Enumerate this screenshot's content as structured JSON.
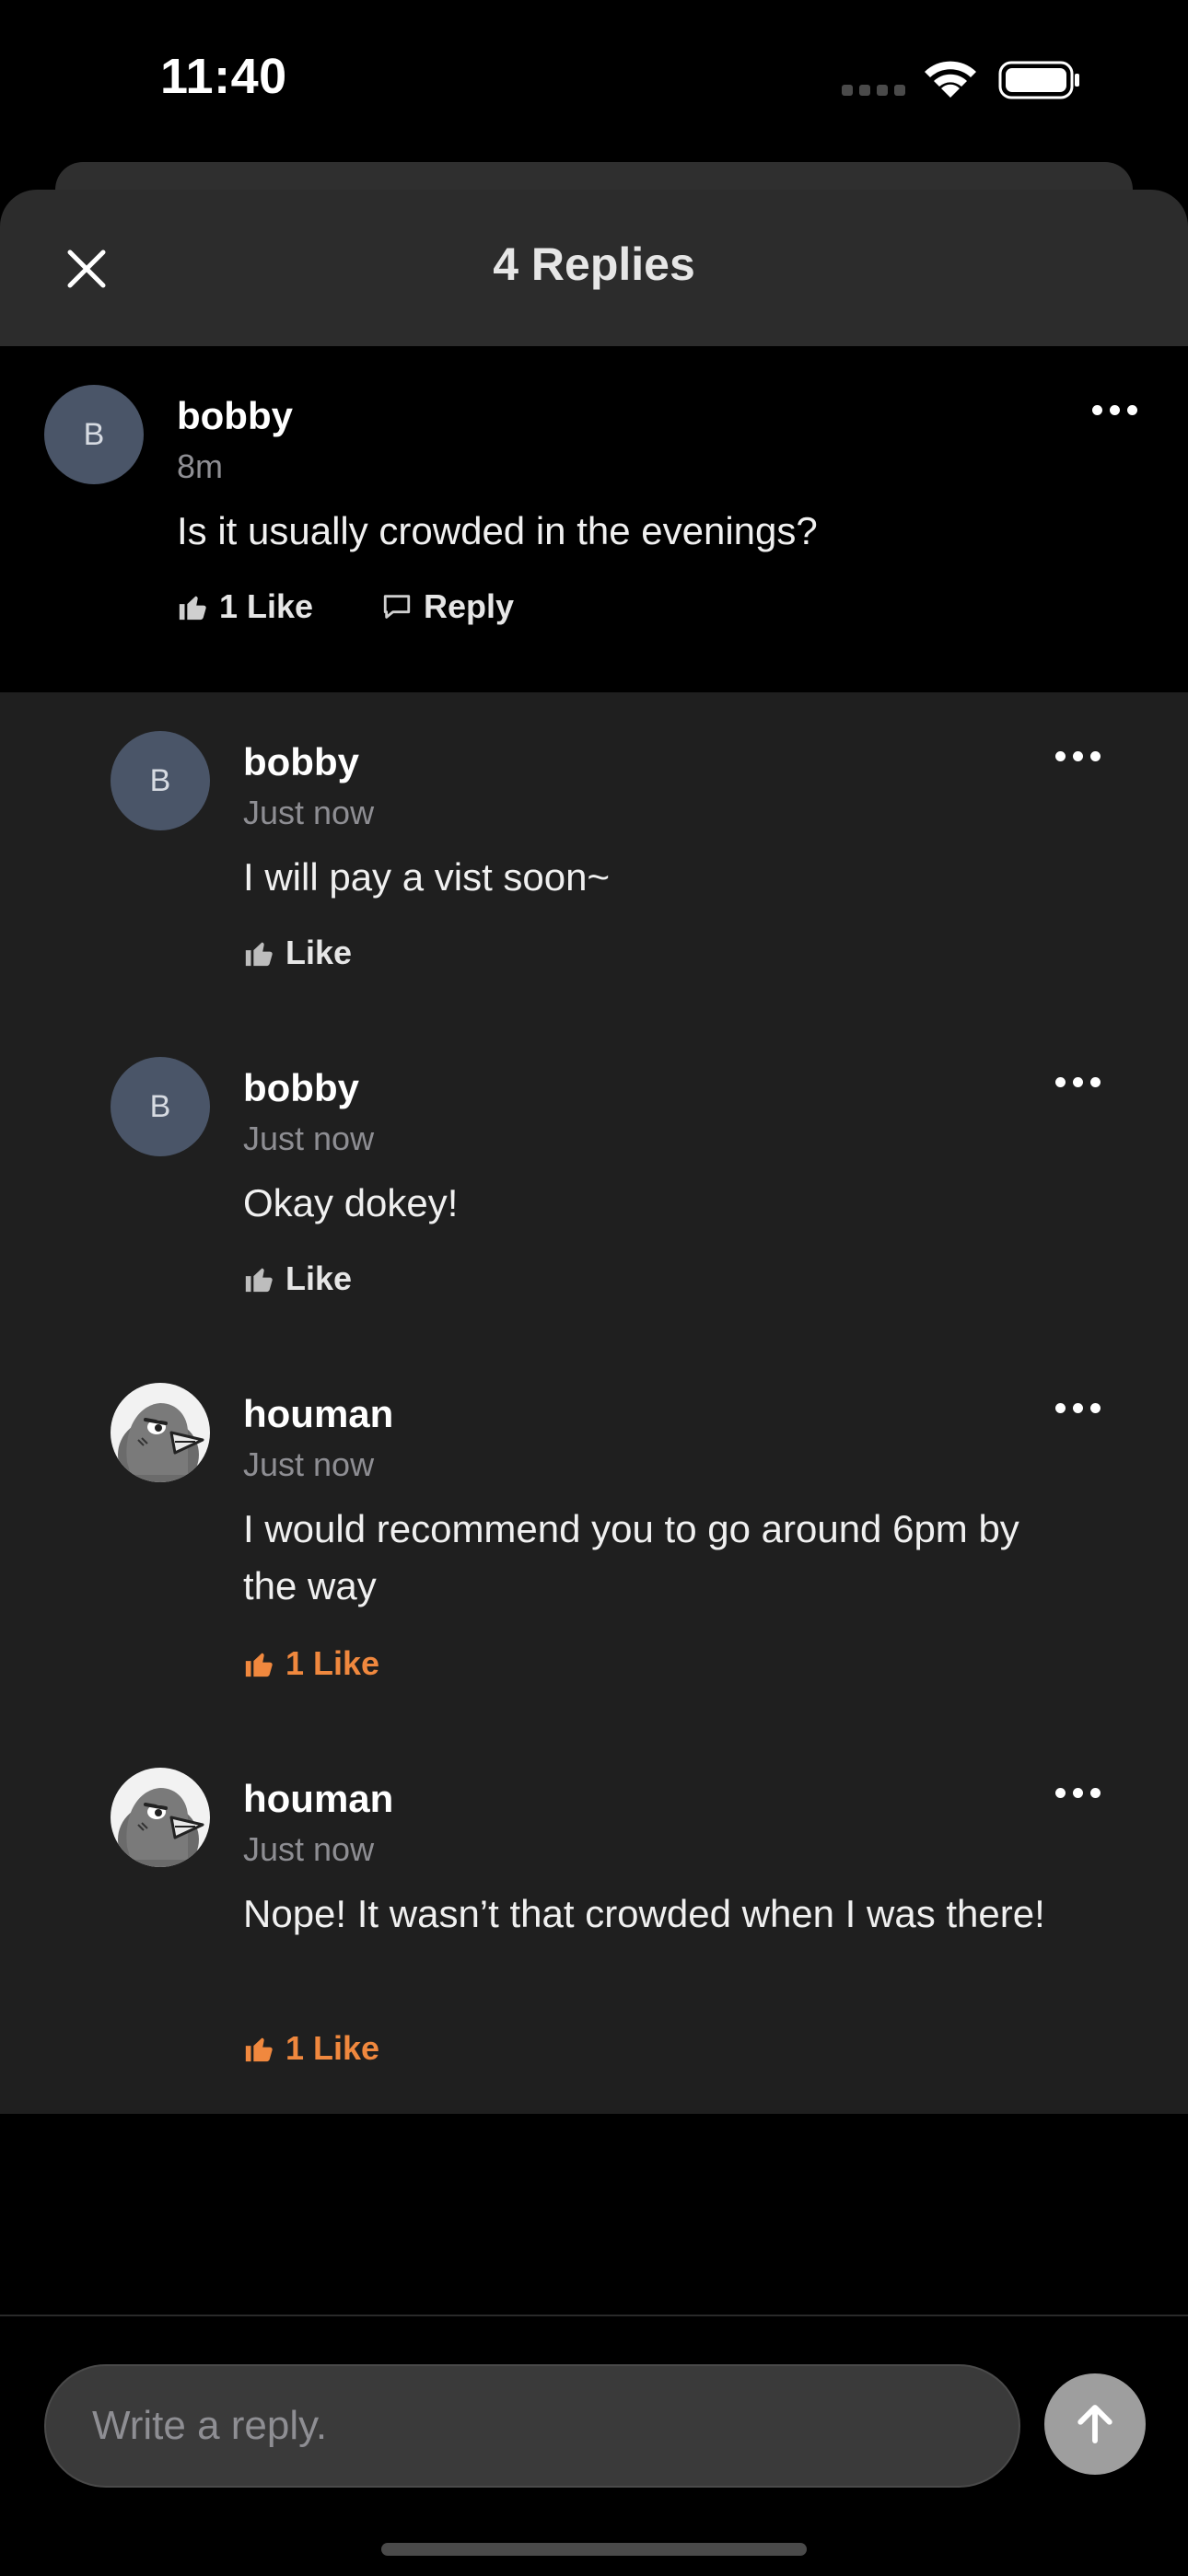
{
  "status_bar": {
    "time": "11:40"
  },
  "header": {
    "title": "4 Replies"
  },
  "parent_comment": {
    "avatar_letter": "B",
    "author": "bobby",
    "time": "8m",
    "text": "Is it usually crowded in the evenings?",
    "like_label": "1 Like",
    "reply_label": "Reply"
  },
  "replies": [
    {
      "avatar_letter": "B",
      "avatar_type": "letter",
      "author": "bobby",
      "time": "Just now",
      "text": "I will pay a vist soon~",
      "like_label": "Like",
      "liked": false
    },
    {
      "avatar_letter": "B",
      "avatar_type": "letter",
      "author": "bobby",
      "time": "Just now",
      "text": "Okay dokey!",
      "like_label": "Like",
      "liked": false
    },
    {
      "avatar_type": "bird-image",
      "author": "houman",
      "time": "Just now",
      "text": "I would recommend you to go around 6pm by the way",
      "like_label": "1 Like",
      "liked": true
    },
    {
      "avatar_type": "bird-image",
      "author": "houman",
      "time": "Just now",
      "text": "Nope! It wasn’t that crowded when I was there!",
      "like_label": "1 Like",
      "liked": true
    }
  ],
  "composer": {
    "placeholder": "Write a reply."
  },
  "colors": {
    "accent_like": "#f0883e",
    "avatar_bg": "#4a5568",
    "reply_bg": "#1f1f1f"
  },
  "icons": {
    "close": "close-icon",
    "more": "more-horizontal-icon",
    "like": "thumbs-up-icon",
    "reply": "speech-bubble-icon",
    "send": "arrow-up-icon"
  }
}
